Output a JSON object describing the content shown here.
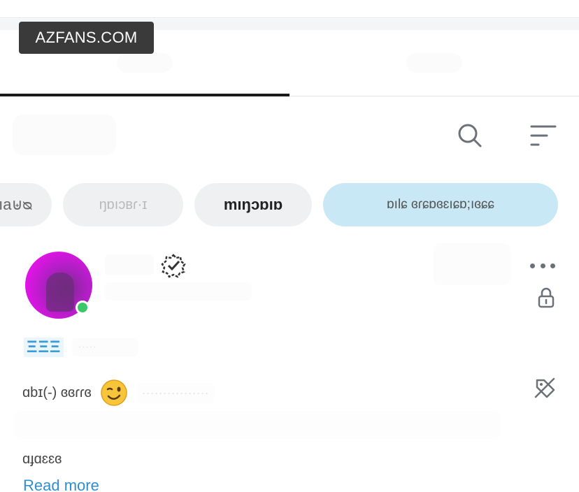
{
  "watermark": {
    "text": "AZFANS.COM"
  },
  "tabs": [
    {
      "label": "",
      "active": true
    },
    {
      "label": "",
      "active": false
    }
  ],
  "list_header": {
    "title": "",
    "icons": {
      "search": "search-icon",
      "filter": "sort-lines-icon"
    }
  },
  "chips": [
    {
      "label": "ıa⊎ᴓ"
    },
    {
      "label": "ŋɒıɔʙɾ·ɪ"
    },
    {
      "label": "mıŋɔɒıɒ"
    },
    {
      "label": "ɒılɕ ɞɾɕɒɞɛıɕɒ;ıɞɕɕ"
    }
  ],
  "profile": {
    "name": "",
    "handle": "",
    "verified_icon": "verified-badge-icon",
    "online": true,
    "price_tag": "ΞΞΞ",
    "price_detail": "·····",
    "bio_line1": "ɑbɪ(-) ɞɞɾɾɞ",
    "bio_emoji": "winking-face-emoji",
    "bio_detail": "················",
    "bio_line3": "ɑɟɑɛɛɞ",
    "read_more": "Read more"
  },
  "colors": {
    "accent": "#2f8ed1",
    "chip_active_bg": "#c9e8f5",
    "online": "#3cc768",
    "tab_underline": "#1a1a1a"
  }
}
